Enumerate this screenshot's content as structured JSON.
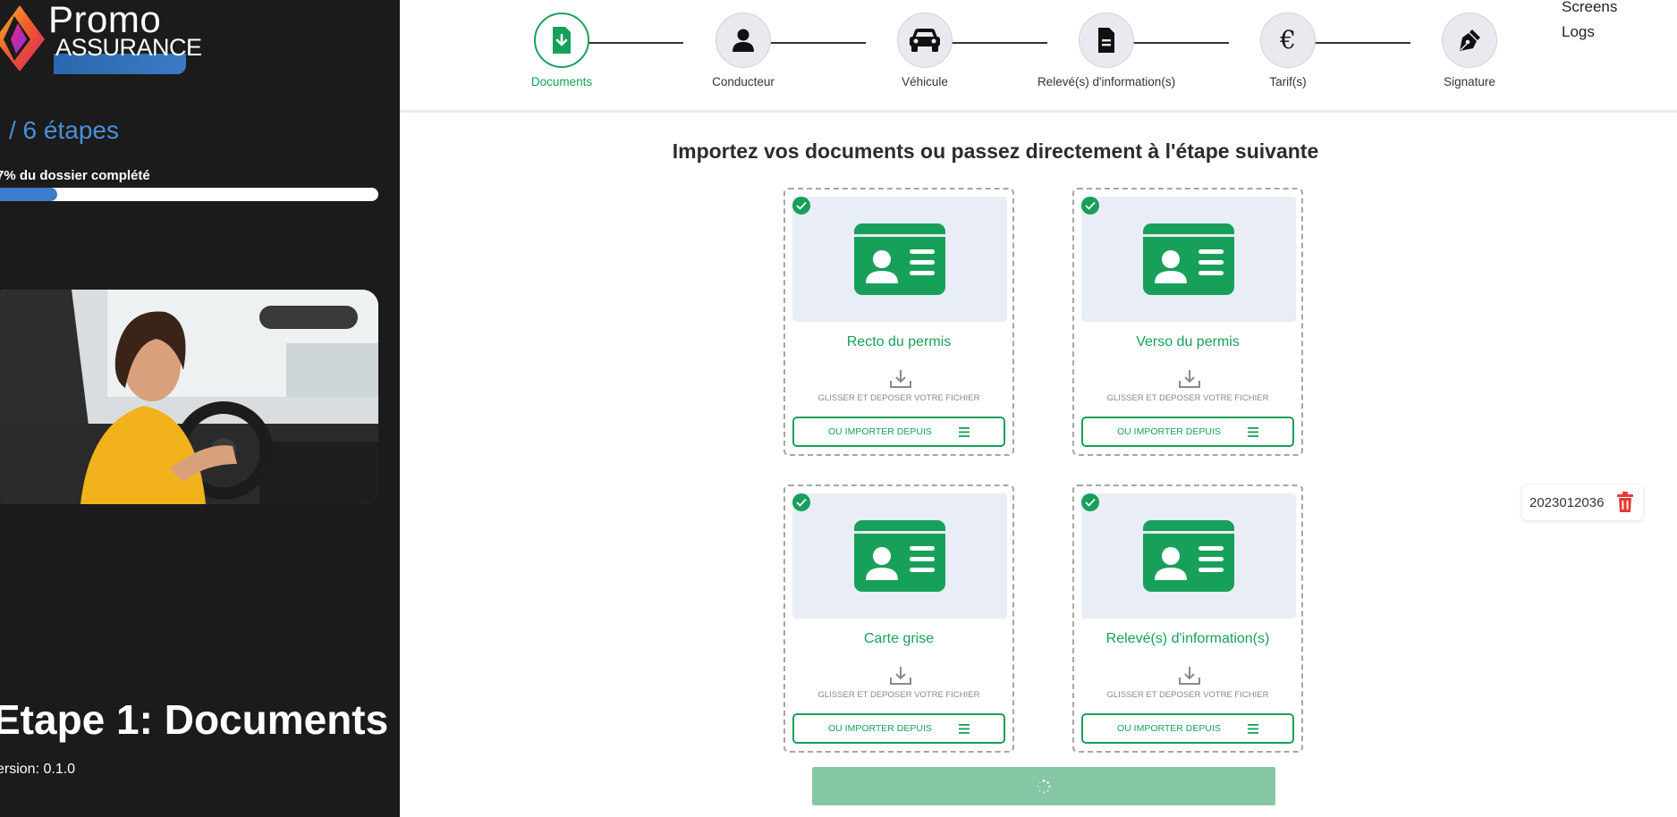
{
  "brand": {
    "name_top": "Promo",
    "name_bottom": "ASSURANCE"
  },
  "sidebar": {
    "steps_count": "/ 6 étapes",
    "progress_label": "7% du dossier complété",
    "progress_percent": 17,
    "etape_title": "Etape 1: Documents",
    "version": "ersion: 0.1.0"
  },
  "stepper": {
    "steps": [
      {
        "label": "Documents",
        "icon": "file-download-icon",
        "active": true
      },
      {
        "label": "Conducteur",
        "icon": "user-icon",
        "active": false
      },
      {
        "label": "Véhicule",
        "icon": "car-icon",
        "active": false
      },
      {
        "label": "Relevé(s) d'information(s)",
        "icon": "document-icon",
        "active": false
      },
      {
        "label": "Tarif(s)",
        "icon": "euro-icon",
        "active": false
      },
      {
        "label": "Signature",
        "icon": "pen-nib-icon",
        "active": false
      }
    ]
  },
  "top_links": {
    "screens": "Screens",
    "logs": "Logs"
  },
  "main": {
    "title": "Importez vos documents ou passez directement à l'étape suivante",
    "documents": [
      {
        "label": "Recto du permis",
        "drop_text": "GLISSER ET DEPOSER VOTRE FICHIER",
        "button": "OU IMPORTER DEPUIS"
      },
      {
        "label": "Verso du permis",
        "drop_text": "GLISSER ET DEPOSER VOTRE FICHIER",
        "button": "OU IMPORTER DEPUIS"
      },
      {
        "label": "Carte grise",
        "drop_text": "GLISSER ET DEPOSER VOTRE FICHIER",
        "button": "OU IMPORTER DEPUIS"
      },
      {
        "label": "Relevé(s) d'information(s)",
        "drop_text": "GLISSER ET DEPOSER VOTRE FICHIER",
        "button": "OU IMPORTER DEPUIS"
      }
    ]
  },
  "dossier_tag": {
    "number": "2023012036"
  },
  "colors": {
    "accent": "#17a05a",
    "sidebar_bg": "#1b1b1b",
    "brand_blue": "#3b7ccc",
    "danger": "#e53935"
  }
}
